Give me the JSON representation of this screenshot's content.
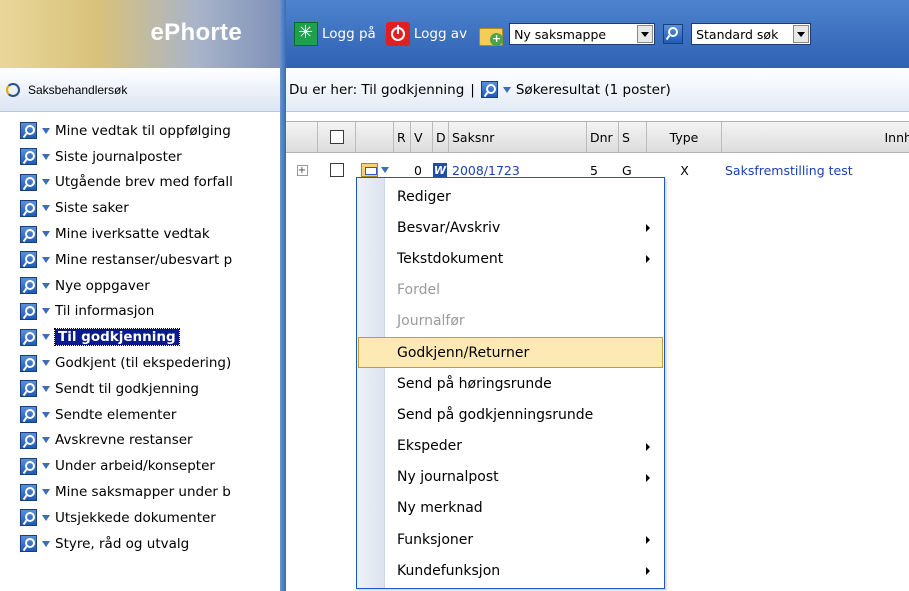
{
  "app": {
    "logo": "ePhorte"
  },
  "left_panel": {
    "title": "Saksbehandlersøk",
    "items": [
      {
        "label": "Mine vedtak til oppfølging",
        "selected": false
      },
      {
        "label": "Siste journalposter",
        "selected": false
      },
      {
        "label": "Utgående brev med forfall",
        "selected": false
      },
      {
        "label": "Siste saker",
        "selected": false
      },
      {
        "label": "Mine iverksatte vedtak",
        "selected": false
      },
      {
        "label": "Mine restanser/ubesvart p",
        "selected": false
      },
      {
        "label": "Nye oppgaver",
        "selected": false
      },
      {
        "label": "Til informasjon",
        "selected": false
      },
      {
        "label": "Til godkjenning",
        "selected": true
      },
      {
        "label": "Godkjent (til ekspedering)",
        "selected": false
      },
      {
        "label": "Sendt til godkjenning",
        "selected": false
      },
      {
        "label": "Sendte elementer",
        "selected": false
      },
      {
        "label": "Avskrevne restanser",
        "selected": false
      },
      {
        "label": "Under arbeid/konsepter",
        "selected": false
      },
      {
        "label": "Mine saksmapper under b",
        "selected": false
      },
      {
        "label": "Utsjekkede dokumenter",
        "selected": false
      },
      {
        "label": "Styre, råd og utvalg",
        "selected": false
      }
    ]
  },
  "toolbar": {
    "login_label": "Logg på",
    "logout_label": "Logg av",
    "new_select_value": "Ny saksmappe",
    "search_select_value": "Standard søk"
  },
  "breadcrumb": {
    "prefix": "Du er her: Til godkjenning",
    "separator": "|",
    "current": "Søkeresultat (1 poster)"
  },
  "grid": {
    "headers": {
      "r": "R",
      "v": "V",
      "d": "D",
      "saksnr": "Saksnr",
      "dnr": "Dnr",
      "s": "S",
      "type": "Type",
      "innhold": "Innhold"
    },
    "rows": [
      {
        "expander": "+",
        "v": "0",
        "saksnr": "2008/1723",
        "dnr": "5",
        "s": "G",
        "type": "X",
        "innhold": "Saksfremstilling test"
      }
    ]
  },
  "context_menu": {
    "items": [
      {
        "label": "Rediger",
        "disabled": false,
        "submenu": false
      },
      {
        "label": "Besvar/Avskriv",
        "disabled": false,
        "submenu": true
      },
      {
        "label": "Tekstdokument",
        "disabled": false,
        "submenu": true
      },
      {
        "label": "Fordel",
        "disabled": true,
        "submenu": false
      },
      {
        "label": "Journalfør",
        "disabled": true,
        "submenu": false
      },
      {
        "label": "Godkjenn/Returner",
        "disabled": false,
        "submenu": false,
        "highlighted": true
      },
      {
        "label": "Send på høringsrunde",
        "disabled": false,
        "submenu": false
      },
      {
        "label": "Send på godkjenningsrunde",
        "disabled": false,
        "submenu": false
      },
      {
        "label": "Ekspeder",
        "disabled": false,
        "submenu": true
      },
      {
        "label": "Ny journalpost",
        "disabled": false,
        "submenu": true
      },
      {
        "label": "Ny merknad",
        "disabled": false,
        "submenu": false
      },
      {
        "label": "Funksjoner",
        "disabled": false,
        "submenu": true
      },
      {
        "label": "Kundefunksjon",
        "disabled": false,
        "submenu": true
      }
    ]
  }
}
